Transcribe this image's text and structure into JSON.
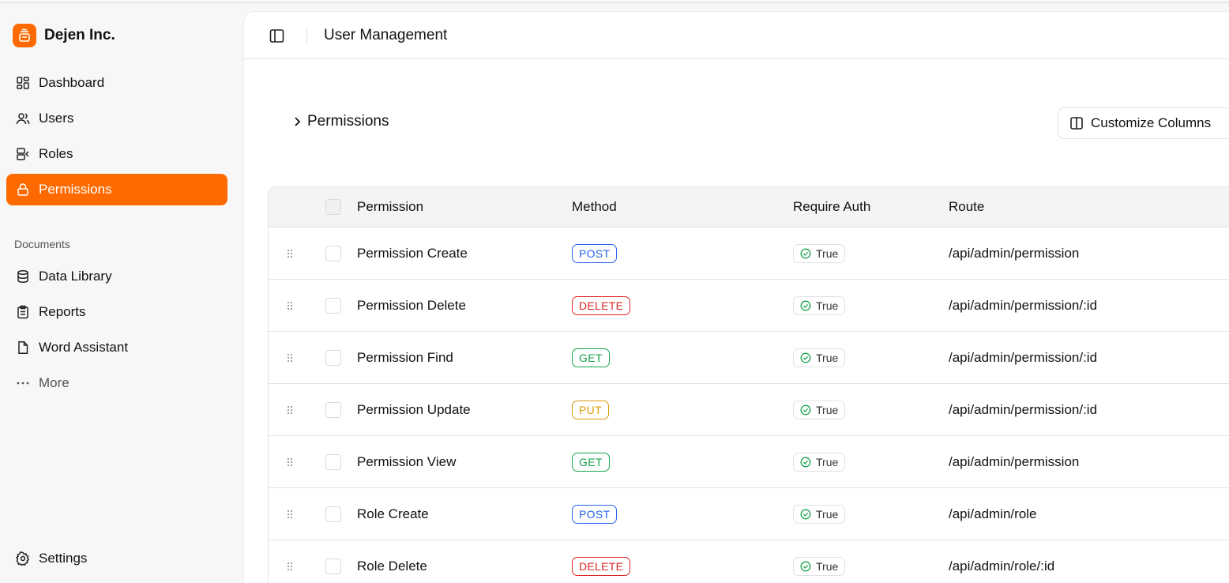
{
  "brand": {
    "name": "Dejen Inc.",
    "accent": "#ff6a00"
  },
  "sidebar": {
    "items": [
      {
        "label": "Dashboard",
        "icon": "dashboard-icon"
      },
      {
        "label": "Users",
        "icon": "users-icon"
      },
      {
        "label": "Roles",
        "icon": "roles-icon"
      },
      {
        "label": "Permissions",
        "icon": "lock-icon",
        "active": true
      }
    ],
    "documents_label": "Documents",
    "documents": [
      {
        "label": "Data Library",
        "icon": "database-icon"
      },
      {
        "label": "Reports",
        "icon": "clipboard-icon"
      },
      {
        "label": "Word Assistant",
        "icon": "file-icon"
      },
      {
        "label": "More",
        "icon": "more-icon"
      }
    ],
    "settings_label": "Settings"
  },
  "header": {
    "title": "User Management"
  },
  "main": {
    "section_title": "Permissions",
    "customize_label": "Customize Columns"
  },
  "table": {
    "columns": [
      "Permission",
      "Method",
      "Require Auth",
      "Route"
    ],
    "method_colors": {
      "POST": "#2563eb",
      "DELETE": "#dc2626",
      "GET": "#16a34a",
      "PUT": "#d99a06"
    },
    "rows": [
      {
        "permission": "Permission Create",
        "method": "POST",
        "auth": "True",
        "route": "/api/admin/permission"
      },
      {
        "permission": "Permission Delete",
        "method": "DELETE",
        "auth": "True",
        "route": "/api/admin/permission/:id"
      },
      {
        "permission": "Permission Find",
        "method": "GET",
        "auth": "True",
        "route": "/api/admin/permission/:id"
      },
      {
        "permission": "Permission Update",
        "method": "PUT",
        "auth": "True",
        "route": "/api/admin/permission/:id"
      },
      {
        "permission": "Permission View",
        "method": "GET",
        "auth": "True",
        "route": "/api/admin/permission"
      },
      {
        "permission": "Role Create",
        "method": "POST",
        "auth": "True",
        "route": "/api/admin/role"
      },
      {
        "permission": "Role Delete",
        "method": "DELETE",
        "auth": "True",
        "route": "/api/admin/role/:id"
      }
    ]
  }
}
